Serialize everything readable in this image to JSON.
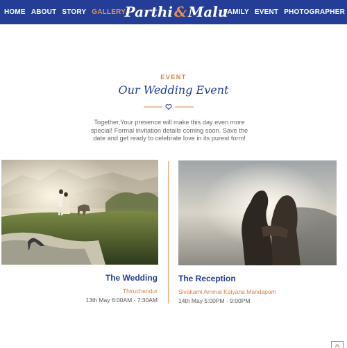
{
  "nav": {
    "left": [
      "HOME",
      "ABOUT",
      "STORY",
      "GALLERY"
    ],
    "right": [
      "FAMILY",
      "EVENT",
      "PHOTOGRAPHER"
    ],
    "active": "GALLERY",
    "brand_left": "Parthi",
    "brand_amp": "&",
    "brand_right": "Malu"
  },
  "section": {
    "eyebrow": "EVENT",
    "title": "Our Wedding Event",
    "intro": "Together,Your presence will make this day even more special! Formal invitation details coming soon. Save the date and get ready to celebrate love in its purest form!"
  },
  "events": [
    {
      "title": "The Wedding",
      "venue": "Thiruchendur",
      "time": "13th May 6:00AM - 7:30AM"
    },
    {
      "title": "The Reception",
      "venue": "Sivakami Ammal Kalyana Mandapam",
      "time": "14th May 5:00PM - 9:00PM"
    }
  ],
  "colors": {
    "navy": "#243d96",
    "accent": "#d8804a"
  },
  "icons": {
    "divider": "heart-icon",
    "scroll": "chevron-up-icon"
  }
}
